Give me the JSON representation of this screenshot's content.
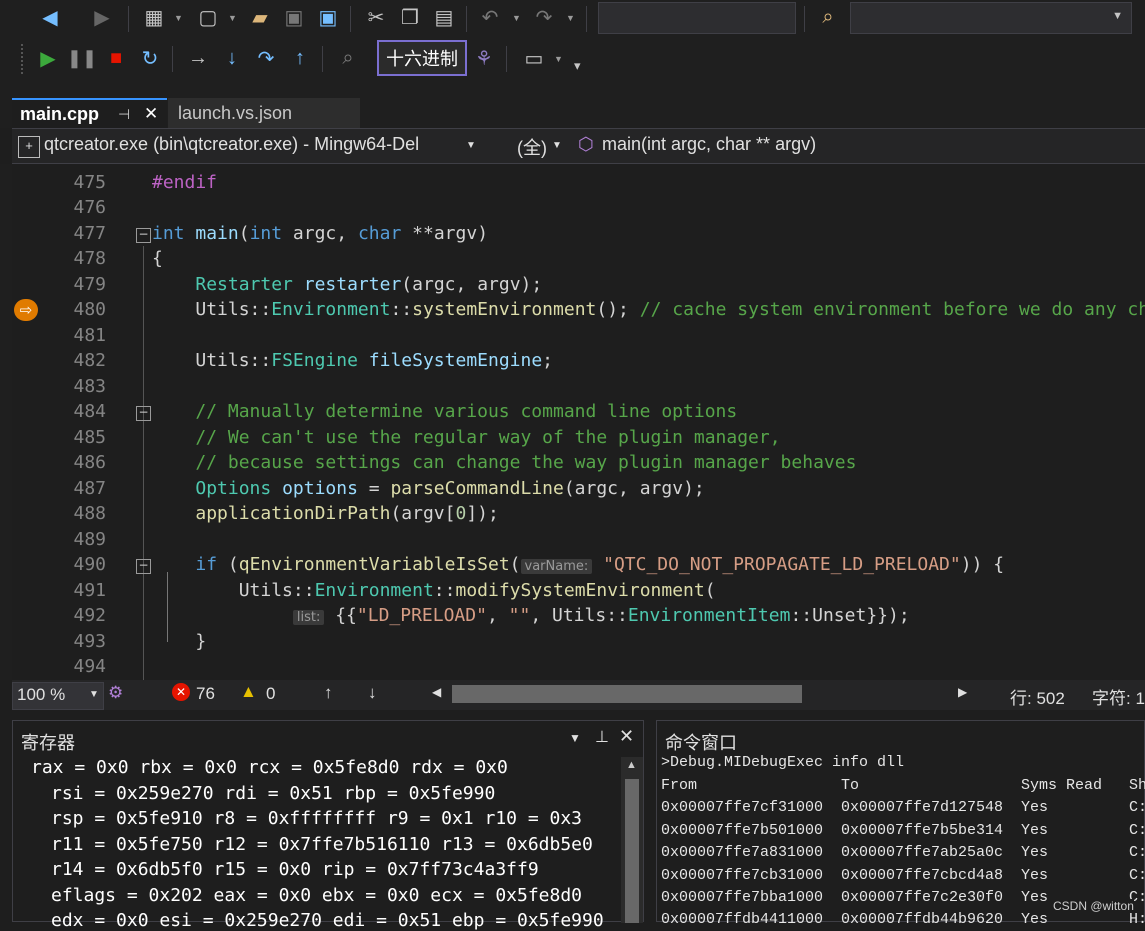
{
  "toolbar": {
    "hex_label": "十六进制"
  },
  "tabs": [
    {
      "label": "main.cpp",
      "pin": "⊣",
      "close": "✕"
    },
    {
      "label": "launch.vs.json"
    }
  ],
  "navbar": {
    "target": "qtcreator.exe (bin\\qtcreator.exe) - Mingw64-Del",
    "scope": "(全)",
    "function": "main(int argc, char ** argv)"
  },
  "editor": {
    "lines": [
      "475",
      "476",
      "477",
      "478",
      "479",
      "480",
      "481",
      "482",
      "483",
      "484",
      "485",
      "486",
      "487",
      "488",
      "489",
      "490",
      "491",
      "492",
      "493",
      "494"
    ],
    "hint_varname": "varName:",
    "hint_list": "list:"
  },
  "status": {
    "zoom": "100 %",
    "errors": "76",
    "warnings": "0",
    "line": "行: 502",
    "col": "字符: 1"
  },
  "registers": {
    "title": "寄存器",
    "lines": [
      "rax = 0x0 rbx = 0x0 rcx = 0x5fe8d0 rdx = 0x0",
      "rsi = 0x259e270 rdi = 0x51 rbp = 0x5fe990",
      "rsp = 0x5fe910 r8 = 0xffffffff r9 = 0x1 r10 = 0x3",
      "r11 = 0x5fe750 r12 = 0x7ffe7b516110 r13 = 0x6db5e0",
      "r14 = 0x6db5f0 r15 = 0x0 rip = 0x7ff73c4a3ff9",
      "eflags = 0x202 eax = 0x0 ebx = 0x0 ecx = 0x5fe8d0",
      "edx = 0x0 esi = 0x259e270 edi = 0x51 ebp = 0x5fe990"
    ]
  },
  "command_window": {
    "title": "命令窗口",
    "command": ">Debug.MIDebugExec info dll",
    "headers": [
      "From",
      "To",
      "Syms Read",
      "Sh"
    ],
    "rows": [
      [
        "0x00007ffe7cf31000",
        "0x00007ffe7d127548",
        "Yes",
        "C:"
      ],
      [
        "0x00007ffe7b501000",
        "0x00007ffe7b5be314",
        "Yes",
        "C:"
      ],
      [
        "0x00007ffe7a831000",
        "0x00007ffe7ab25a0c",
        "Yes",
        "C:"
      ],
      [
        "0x00007ffe7cb31000",
        "0x00007ffe7cbcd4a8",
        "Yes",
        "C:"
      ],
      [
        "0x00007ffe7bba1000",
        "0x00007ffe7c2e30f0",
        "Yes",
        "C:"
      ],
      [
        "0x00007ffdb4411000",
        "0x00007ffdb44b9620",
        "Yes",
        "H:"
      ]
    ],
    "watermark": "CSDN @witton"
  }
}
